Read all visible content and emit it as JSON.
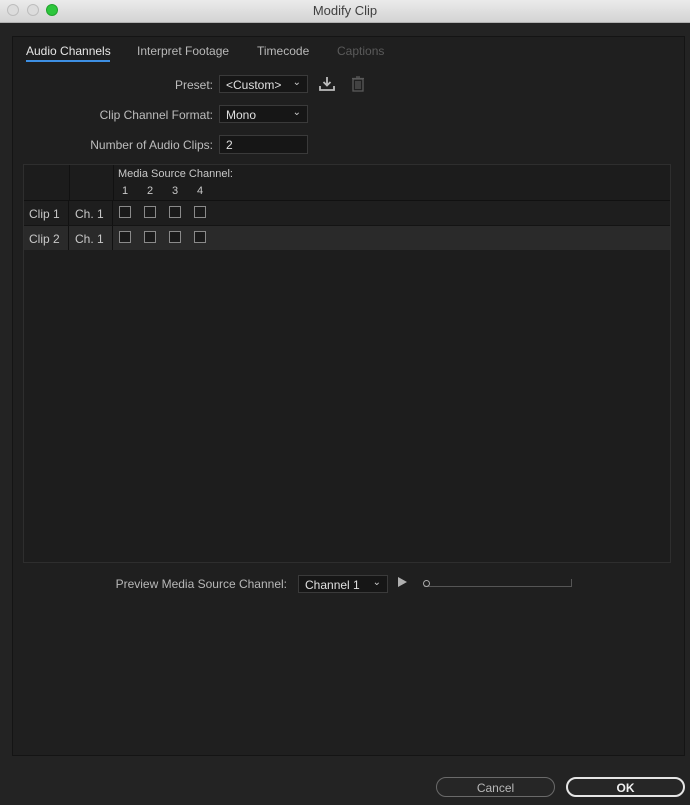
{
  "window": {
    "title": "Modify Clip"
  },
  "tabs": [
    {
      "label": "Audio Channels",
      "state": "active"
    },
    {
      "label": "Interpret Footage",
      "state": "normal"
    },
    {
      "label": "Timecode",
      "state": "normal"
    },
    {
      "label": "Captions",
      "state": "disabled"
    }
  ],
  "form": {
    "preset_label": "Preset:",
    "preset_value": "<Custom>",
    "format_label": "Clip Channel Format:",
    "format_value": "Mono",
    "clips_label": "Number of Audio Clips:",
    "clips_value": "2"
  },
  "grid": {
    "header": "Media Source Channel:",
    "channels": [
      "1",
      "2",
      "3",
      "4"
    ],
    "rows": [
      {
        "clip": "Clip 1",
        "channel": "Ch. 1",
        "checked": [
          false,
          false,
          false,
          false
        ]
      },
      {
        "clip": "Clip 2",
        "channel": "Ch. 1",
        "checked": [
          false,
          false,
          false,
          false
        ]
      }
    ]
  },
  "preview": {
    "label": "Preview Media Source Channel:",
    "value": "Channel 1",
    "position": 0
  },
  "buttons": {
    "cancel": "Cancel",
    "ok": "OK"
  },
  "colors": {
    "accent": "#3d8fe3",
    "zoom_button": "#2dc63c"
  }
}
